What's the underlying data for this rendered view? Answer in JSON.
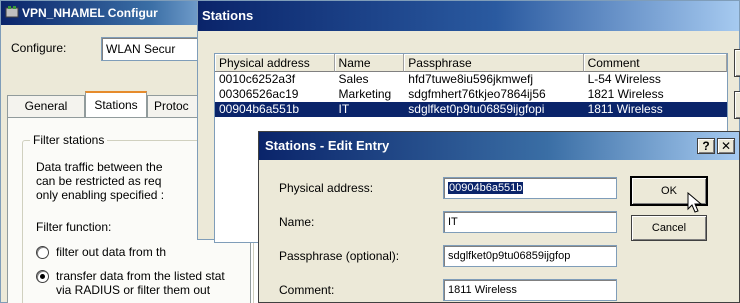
{
  "bg_window": {
    "title": "VPN_NHAMEL Configur",
    "configure_label": "Configure:",
    "configure_value": "WLAN Secur",
    "tabs": [
      "General",
      "Stations",
      "Protoc"
    ],
    "filter_group_label": "Filter stations",
    "desc_lines": [
      "Data traffic between the",
      "can be restricted as req",
      "only enabling specified :"
    ],
    "filter_function_label": "Filter function:",
    "radio_options": [
      "filter out data from th",
      "transfer data from the listed stat",
      "via RADIUS or filter them out"
    ]
  },
  "stations_window": {
    "title": "Stations",
    "columns": [
      "Physical address",
      "Name",
      "Passphrase",
      "Comment"
    ],
    "rows": [
      {
        "address": "0010c6252a3f",
        "name": "Sales",
        "passphrase": "hfd7tuwe8iu596jkmwefj",
        "comment": "L-54 Wireless"
      },
      {
        "address": "00306526ac19",
        "name": "Marketing",
        "passphrase": "sdgfmhert76tkjeo7864ij56",
        "comment": "1821 Wireless"
      },
      {
        "address": "00904b6a551b",
        "name": "IT",
        "passphrase": "sdglfket0p9tu06859ijgfopi",
        "comment": "1811 Wireless"
      }
    ],
    "selected_row": 2
  },
  "edit_dialog": {
    "title": "Stations - Edit Entry",
    "help_button": "?",
    "close_button": "✕",
    "physical_address_label": "Physical address:",
    "physical_address_value": "00904b6a551b",
    "name_label": "Name:",
    "name_value": "IT",
    "passphrase_label": "Passphrase (optional):",
    "passphrase_value": "sdglfket0p9tu06859ijgfop",
    "comment_label": "Comment:",
    "comment_value": "1811 Wireless",
    "ok_label": "OK",
    "cancel_label": "Cancel"
  },
  "colors": {
    "titlebar_start": "#0a246a",
    "selection": "#0a246a",
    "dialog_face": "#ece9d8"
  }
}
